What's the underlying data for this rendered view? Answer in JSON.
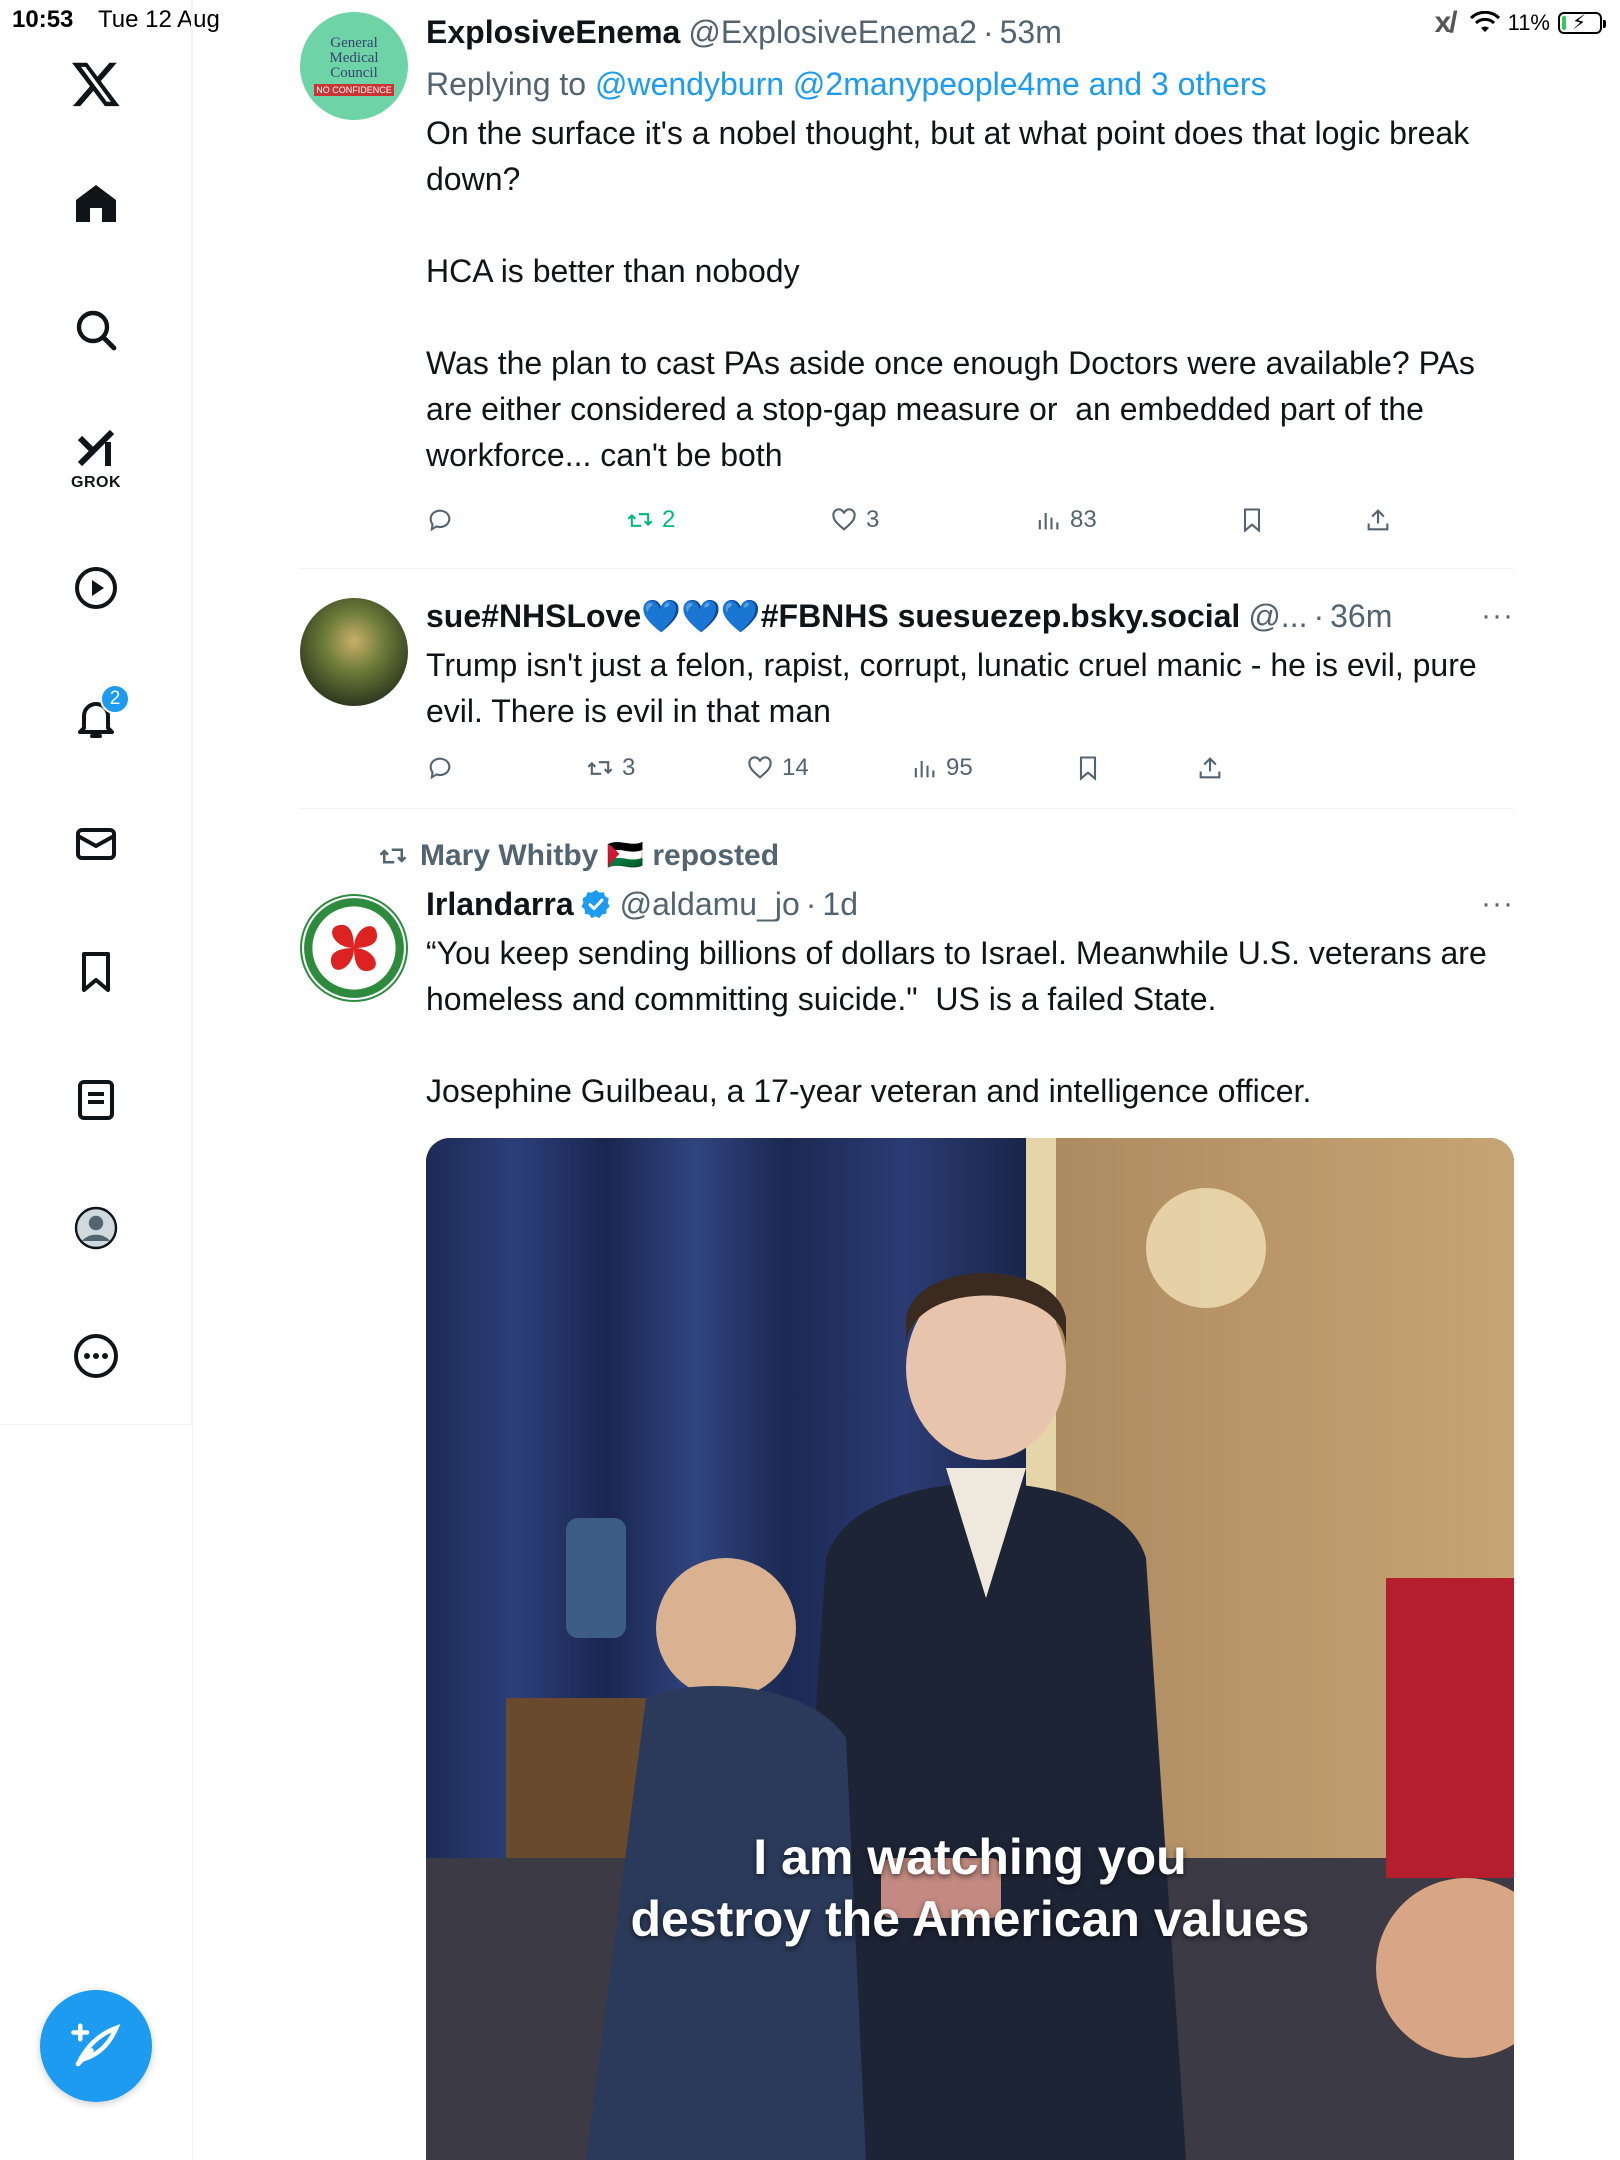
{
  "status_bar": {
    "time": "10:53",
    "date": "Tue 12 Aug",
    "battery": "11%",
    "battery_level": 0.11
  },
  "sidebar": {
    "items": [
      {
        "name": "home",
        "icon": "home-icon"
      },
      {
        "name": "explore",
        "icon": "search-icon"
      },
      {
        "name": "grok",
        "icon": "grok-icon",
        "label": "GROK"
      },
      {
        "name": "videos",
        "icon": "play-icon"
      },
      {
        "name": "notifications",
        "icon": "bell-icon",
        "badge": "2"
      },
      {
        "name": "messages",
        "icon": "mail-icon"
      },
      {
        "name": "bookmarks",
        "icon": "bookmark-icon"
      },
      {
        "name": "lists",
        "icon": "list-icon"
      },
      {
        "name": "profile",
        "icon": "profile-icon"
      },
      {
        "name": "more",
        "icon": "more-icon"
      }
    ],
    "compose_icon": "compose-post-icon"
  },
  "posts": [
    {
      "name": "ExplosiveEnema",
      "handle": "@ExplosiveEnema2",
      "time": "53m",
      "avatar_text": [
        "General",
        "Medical",
        "Council",
        "NO CONFIDENCE"
      ],
      "replying_prefix": "Replying to",
      "replying_to": "@wendyburn @2manypeople4me and 3 others",
      "text": "On the surface it's a nobel thought, but at what point does that logic break down?\n\nHCA is better than nobody\n\nWas the plan to cast PAs aside once enough Doctors were available? PAs are either considered a stop-gap measure or  an embedded part of the workforce... can't be both",
      "stats": {
        "reposts": "2",
        "likes": "3",
        "views": "83"
      }
    },
    {
      "name": "sue#NHSLove💙💙💙#FBNHS suesuezep.bsky.social",
      "handle": "@...",
      "time": "36m",
      "text": "Trump isn't just a felon, rapist, corrupt, lunatic cruel manic - he is evil, pure evil. There is evil in that man",
      "stats": {
        "reposts": "3",
        "likes": "14",
        "views": "95"
      }
    },
    {
      "reposted_by": "Mary Whitby 🇵🇸 reposted",
      "name": "Irlandarra",
      "handle": "@aldamu_jo",
      "time": "1d",
      "text": "“You keep sending billions of dollars to Israel. Meanwhile U.S. veterans are homeless and committing suicide.\"  US is a failed State.\n\nJosephine Guilbeau, a 17-year veteran and intelligence officer.",
      "media_caption_1": "I am watching you",
      "media_caption_2": "destroy the American values"
    }
  ],
  "colors": {
    "accent": "#1d9bf0",
    "repost_green": "#00ba7c",
    "secondary_text": "#536471"
  }
}
